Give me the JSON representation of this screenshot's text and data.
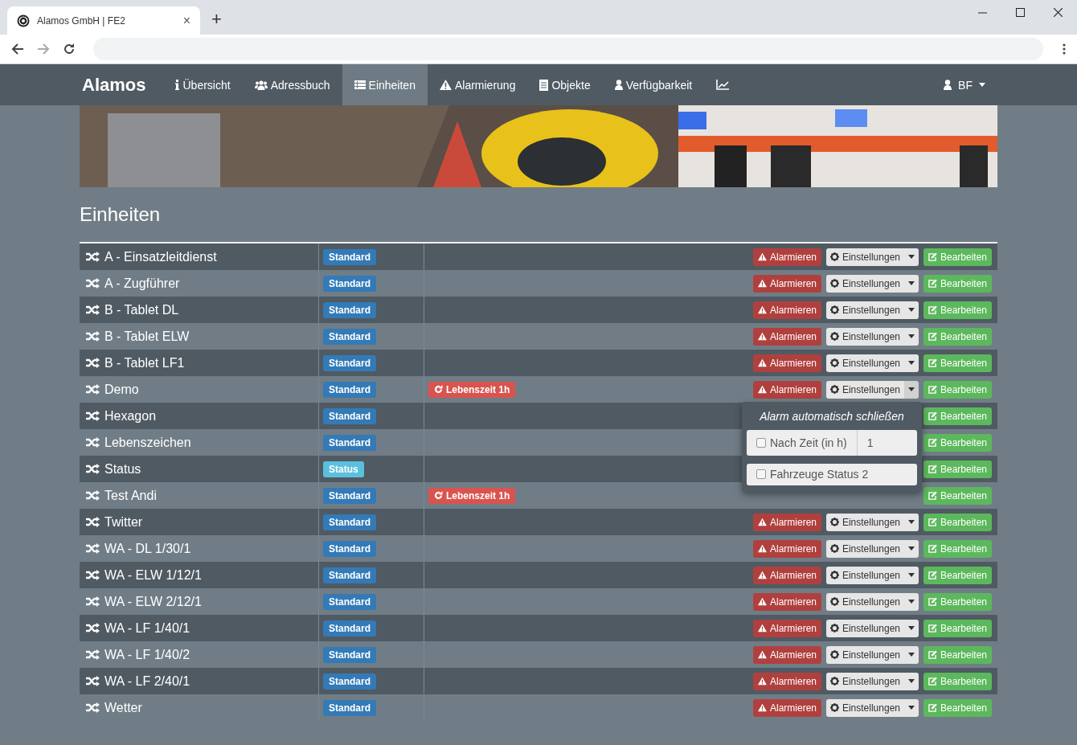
{
  "browser": {
    "tab_title": "Alamos GmbH | FE2",
    "new_tab": "+",
    "close_tab": "×"
  },
  "navbar": {
    "brand": "Alamos",
    "items": [
      {
        "label": "Übersicht",
        "selected": false
      },
      {
        "label": "Adressbuch",
        "selected": false
      },
      {
        "label": "Einheiten",
        "selected": true
      },
      {
        "label": "Alarmierung",
        "selected": false
      },
      {
        "label": "Objekte",
        "selected": false
      },
      {
        "label": "Verfügbarkeit",
        "selected": false
      },
      {
        "selected": false
      }
    ],
    "user": "BF"
  },
  "heading": "Einheiten",
  "units": [
    {
      "name": "A - Einsatzleitdienst",
      "type": {
        "label": "Standard",
        "kind": "standard"
      },
      "alarm": "Alarmieren",
      "settings": "Einstellungen",
      "edit": "Bearbeiten"
    },
    {
      "name": "A - Zugführer",
      "type": {
        "label": "Standard",
        "kind": "standard"
      },
      "alarm": "Alarmieren",
      "settings": "Einstellungen",
      "edit": "Bearbeiten"
    },
    {
      "name": "B - Tablet DL",
      "type": {
        "label": "Standard",
        "kind": "standard"
      },
      "alarm": "Alarmieren",
      "settings": "Einstellungen",
      "edit": "Bearbeiten"
    },
    {
      "name": "B - Tablet ELW",
      "type": {
        "label": "Standard",
        "kind": "standard"
      },
      "alarm": "Alarmieren",
      "settings": "Einstellungen",
      "edit": "Bearbeiten"
    },
    {
      "name": "B - Tablet LF1",
      "type": {
        "label": "Standard",
        "kind": "standard"
      },
      "alarm": "Alarmieren",
      "settings": "Einstellungen",
      "edit": "Bearbeiten"
    },
    {
      "name": "Demo",
      "type": {
        "label": "Standard",
        "kind": "standard"
      },
      "lifetime": "Lebenszeit 1h",
      "alarm": "Alarmieren",
      "settings": "Einstellungen",
      "edit": "Bearbeiten",
      "settings_open": true,
      "dropdown": {
        "header": "Alarm automatisch schließen",
        "time_option": {
          "label": "Nach Zeit (in h)",
          "checked": false,
          "value": "1"
        },
        "status_option": {
          "label": "Fahrzeuge Status 2",
          "checked": false
        }
      }
    },
    {
      "name": "Hexagon",
      "type": {
        "label": "Standard",
        "kind": "standard"
      },
      "edit": "Bearbeiten"
    },
    {
      "name": "Lebenszeichen",
      "type": {
        "label": "Standard",
        "kind": "standard"
      },
      "edit": "Bearbeiten"
    },
    {
      "name": "Status",
      "type": {
        "label": "Status",
        "kind": "status"
      },
      "edit": "Bearbeiten"
    },
    {
      "name": "Test Andi",
      "type": {
        "label": "Standard",
        "kind": "standard"
      },
      "lifetime": "Lebenszeit 1h",
      "edit": "Bearbeiten"
    },
    {
      "name": "Twitter",
      "type": {
        "label": "Standard",
        "kind": "standard"
      },
      "alarm": "Alarmieren",
      "settings": "Einstellungen",
      "edit": "Bearbeiten"
    },
    {
      "name": "WA - DL 1/30/1",
      "type": {
        "label": "Standard",
        "kind": "standard"
      },
      "alarm": "Alarmieren",
      "settings": "Einstellungen",
      "edit": "Bearbeiten"
    },
    {
      "name": "WA - ELW 1/12/1",
      "type": {
        "label": "Standard",
        "kind": "standard"
      },
      "alarm": "Alarmieren",
      "settings": "Einstellungen",
      "edit": "Bearbeiten"
    },
    {
      "name": "WA - ELW 2/12/1",
      "type": {
        "label": "Standard",
        "kind": "standard"
      },
      "alarm": "Alarmieren",
      "settings": "Einstellungen",
      "edit": "Bearbeiten"
    },
    {
      "name": "WA - LF 1/40/1",
      "type": {
        "label": "Standard",
        "kind": "standard"
      },
      "alarm": "Alarmieren",
      "settings": "Einstellungen",
      "edit": "Bearbeiten"
    },
    {
      "name": "WA - LF 1/40/2",
      "type": {
        "label": "Standard",
        "kind": "standard"
      },
      "alarm": "Alarmieren",
      "settings": "Einstellungen",
      "edit": "Bearbeiten"
    },
    {
      "name": "WA - LF 2/40/1",
      "type": {
        "label": "Standard",
        "kind": "standard"
      },
      "alarm": "Alarmieren",
      "settings": "Einstellungen",
      "edit": "Bearbeiten"
    },
    {
      "name": "Wetter",
      "type": {
        "label": "Standard",
        "kind": "standard"
      },
      "alarm": "Alarmieren",
      "settings": "Einstellungen",
      "edit": "Bearbeiten"
    }
  ]
}
